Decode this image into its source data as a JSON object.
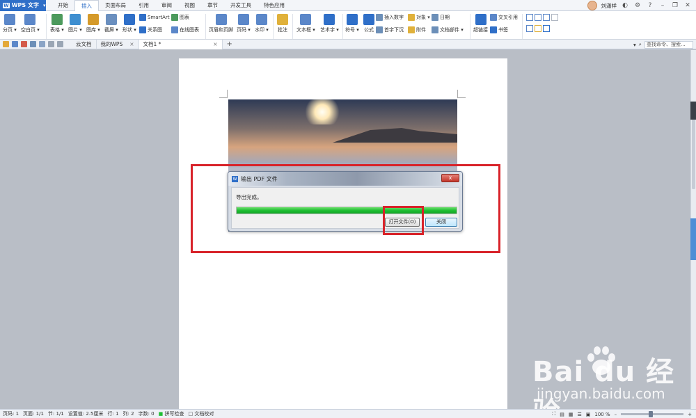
{
  "app": {
    "name": "WPS 文字",
    "logo_letter": "W"
  },
  "menu": {
    "tabs": [
      "开始",
      "插入",
      "页面布局",
      "引用",
      "审阅",
      "视图",
      "章节",
      "开发工具",
      "特色应用"
    ],
    "active_tab": "插入",
    "user_name": "刘潇祥"
  },
  "ribbon": {
    "big_buttons": [
      {
        "name": "break",
        "label": "分页 ▾",
        "color": "#5b87c9"
      },
      {
        "name": "blank-page",
        "label": "空白页 ▾",
        "color": "#5b87c9"
      },
      {
        "name": "table",
        "label": "表格 ▾",
        "color": "#4c9a5c"
      },
      {
        "name": "picture",
        "label": "图片 ▾",
        "color": "#3f8fd0"
      },
      {
        "name": "gallery",
        "label": "图库 ▾",
        "color": "#d59a2a"
      },
      {
        "name": "screenshot",
        "label": "截屏 ▾",
        "color": "#6a8fbf"
      },
      {
        "name": "shape",
        "label": "形状 ▾",
        "color": "#2f6fc8"
      },
      {
        "name": "header-footer",
        "label": "页眉和页脚",
        "color": "#5b87c9"
      },
      {
        "name": "page-number",
        "label": "页码 ▾",
        "color": "#5b87c9"
      },
      {
        "name": "watermark",
        "label": "水印 ▾",
        "color": "#5b87c9"
      },
      {
        "name": "comment",
        "label": "批注",
        "color": "#e0b13b"
      },
      {
        "name": "textbox",
        "label": "文本框 ▾",
        "color": "#5b87c9"
      },
      {
        "name": "wordart",
        "label": "艺术字 ▾",
        "color": "#2f6fc8"
      },
      {
        "name": "symbol",
        "label": "符号 ▾",
        "color": "#2f6fc8"
      },
      {
        "name": "formula",
        "label": "公式",
        "color": "#2f6fc8"
      },
      {
        "name": "hyperlink",
        "label": "超链接",
        "color": "#2f6fc8"
      }
    ],
    "small_buttons": [
      {
        "name": "smartart",
        "label": "SmartArt"
      },
      {
        "name": "chart",
        "label": "图表"
      },
      {
        "name": "relation",
        "label": "关系图"
      },
      {
        "name": "online-chart",
        "label": "在线图表"
      },
      {
        "name": "insert-number",
        "label": "插入数字"
      },
      {
        "name": "object",
        "label": "对象 ▾"
      },
      {
        "name": "date",
        "label": "日期"
      },
      {
        "name": "drop-cap",
        "label": "首字下沉"
      },
      {
        "name": "attachment",
        "label": "附件"
      },
      {
        "name": "doc-parts",
        "label": "文档部件 ▾"
      },
      {
        "name": "cross-reference",
        "label": "交叉引用"
      },
      {
        "name": "bookmark",
        "label": "书签"
      }
    ]
  },
  "doc_tabs": {
    "items": [
      {
        "label": "云文档",
        "active": false
      },
      {
        "label": "我的WPS",
        "active": false
      },
      {
        "label": "文档1 *",
        "active": true
      }
    ],
    "search_placeholder": "查找命令、搜索..."
  },
  "dialog": {
    "title": "输出 PDF 文件",
    "message": "导出完成。",
    "progress": 1.0,
    "open_file_label": "打开文件(O)",
    "close_label": "关闭",
    "close_glyph": "x"
  },
  "status": {
    "page": "页码: 1",
    "pages": "页面: 1/1",
    "section": "节: 1/1",
    "setting": "设置值: 2.5厘米",
    "row": "行: 1",
    "col": "列: 2",
    "words": "字数: 0",
    "spellcheck": "拼写检查",
    "proofread": "文档校对",
    "zoom": "100 %"
  },
  "watermark": {
    "brand": "Bai du 经验",
    "url": "jingyan.baidu.com"
  },
  "colors": {
    "accent": "#2f6fc8",
    "annotation": "#d8232a",
    "progress": "#1fbf33"
  }
}
